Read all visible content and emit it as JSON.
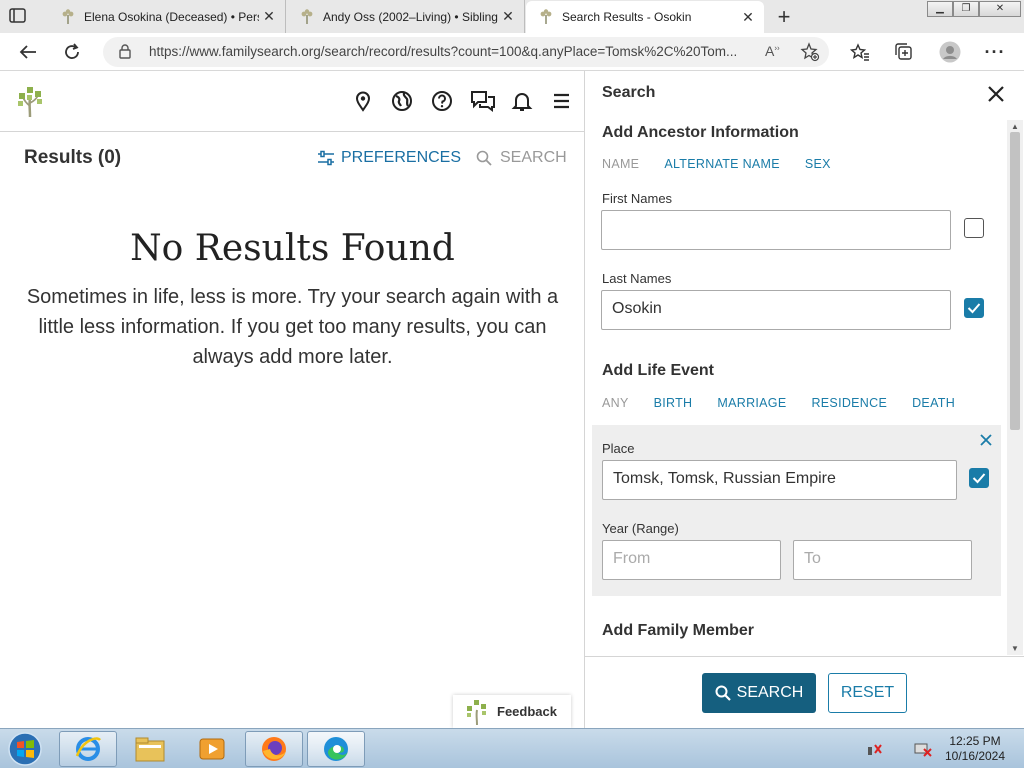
{
  "browser": {
    "tabs": [
      {
        "title": "Elena Osokina (Deceased) • Pers",
        "active": false
      },
      {
        "title": "Andy Oss (2002–Living) • Sibling",
        "active": false
      },
      {
        "title": "Search Results - Osokin",
        "active": true
      }
    ],
    "url": "https://www.familysearch.org/search/record/results?count=100&q.anyPlace=Tomsk%2C%20Tom..."
  },
  "results": {
    "title": "Results (0)",
    "preferences_label": "PREFERENCES",
    "search_label": "SEARCH",
    "no_results_title": "No Results Found",
    "no_results_text": "Sometimes in life, less is more. Try your search again with a little less information. If you get too many results, you can always add more later."
  },
  "feedback_label": "Feedback",
  "panel": {
    "title": "Search",
    "ancestor_heading": "Add Ancestor Information",
    "ancestor_chips": [
      "NAME",
      "ALTERNATE NAME",
      "SEX"
    ],
    "first_names_label": "First Names",
    "first_names_value": "",
    "first_names_exact": false,
    "last_names_label": "Last Names",
    "last_names_value": "Osokin",
    "last_names_exact": true,
    "life_event_heading": "Add Life Event",
    "life_event_chips": [
      "ANY",
      "BIRTH",
      "MARRIAGE",
      "RESIDENCE",
      "DEATH"
    ],
    "place_label": "Place",
    "place_value": "Tomsk, Tomsk, Russian Empire",
    "place_exact": true,
    "year_label": "Year (Range)",
    "year_from_placeholder": "From",
    "year_to_placeholder": "To",
    "family_heading": "Add Family Member",
    "search_button": "SEARCH",
    "reset_button": "RESET"
  },
  "taskbar": {
    "time": "12:25 PM",
    "date": "10/16/2024"
  },
  "colors": {
    "accent": "#1a7ca8",
    "search_button": "#155f7f",
    "logo_green": "#8db04c"
  }
}
